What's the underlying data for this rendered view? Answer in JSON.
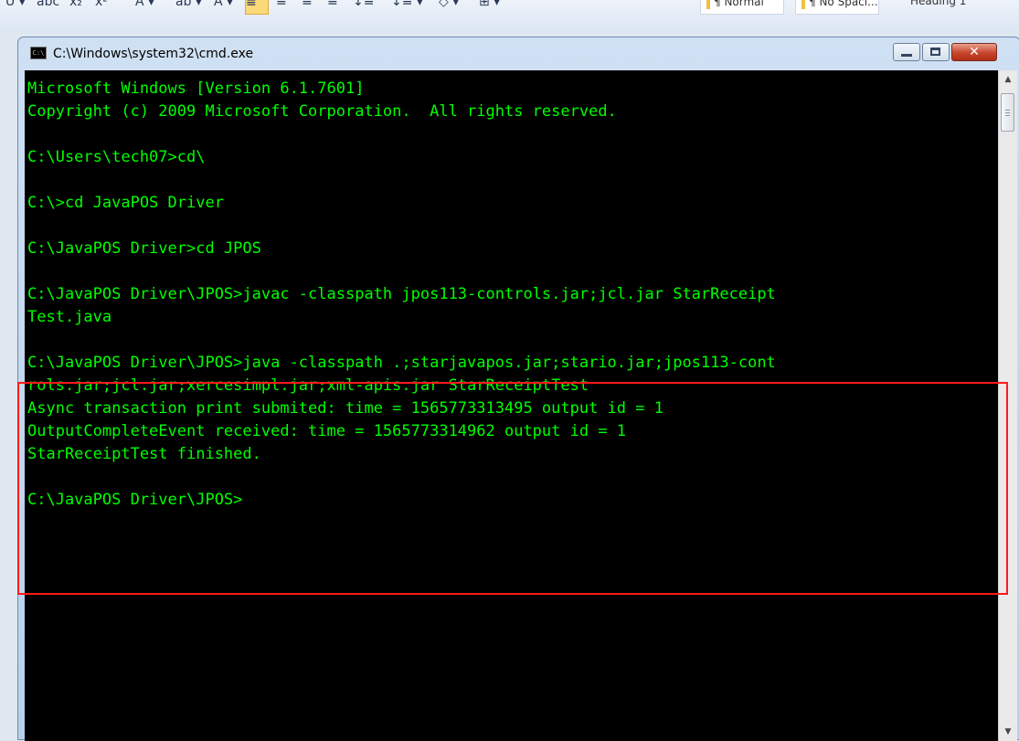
{
  "ribbon": {
    "style_normal": "¶ Normal",
    "style_nospacing": "¶ No Spaci...",
    "style_heading1": "Heading 1"
  },
  "window": {
    "icon_text": "C:\\",
    "title": "C:\\Windows\\system32\\cmd.exe",
    "close_glyph": "✕"
  },
  "console": {
    "lines": [
      "Microsoft Windows [Version 6.1.7601]",
      "Copyright (c) 2009 Microsoft Corporation.  All rights reserved.",
      "",
      "C:\\Users\\tech07>cd\\",
      "",
      "C:\\>cd JavaPOS Driver",
      "",
      "C:\\JavaPOS Driver>cd JPOS",
      "",
      "C:\\JavaPOS Driver\\JPOS>javac -classpath jpos113-controls.jar;jcl.jar StarReceipt",
      "Test.java",
      "",
      "C:\\JavaPOS Driver\\JPOS>java -classpath .;starjavapos.jar;stario.jar;jpos113-cont",
      "rols.jar;jcl.jar;xercesimpl.jar;xml-apis.jar StarReceiptTest",
      "Async transaction print submited: time = 1565773313495 output id = 1",
      "OutputCompleteEvent received: time = 1565773314962 output id = 1",
      "StarReceiptTest finished.",
      "",
      "C:\\JavaPOS Driver\\JPOS>"
    ]
  },
  "scrollbar": {
    "up_glyph": "▲",
    "down_glyph": "▼"
  },
  "colors": {
    "console_bg": "#000000",
    "console_fg": "#00ff00",
    "highlight": "#ff1a1a"
  }
}
